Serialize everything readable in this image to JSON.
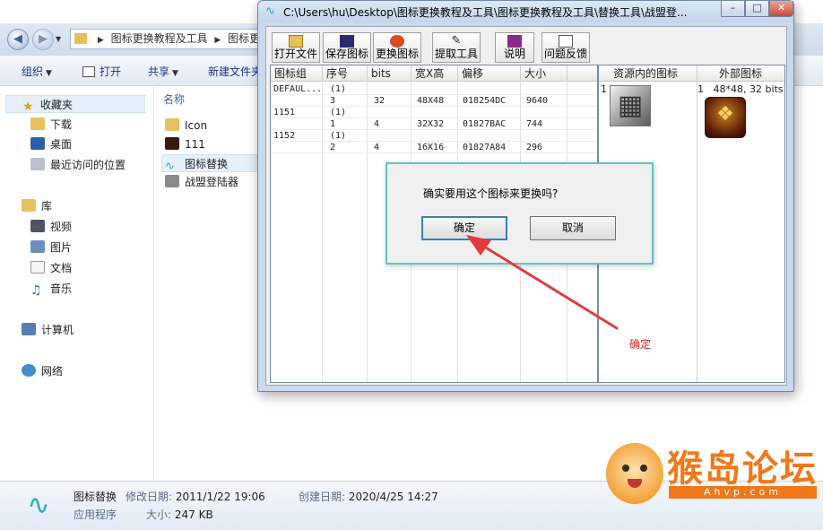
{
  "explorer": {
    "breadcrumb": [
      "图标更换教程及工具",
      "图标更"
    ],
    "toolbar": {
      "organize": "组织",
      "open": "打开",
      "share": "共享",
      "new_folder": "新建文件夹"
    },
    "nav": {
      "favorites": "收藏夹",
      "downloads": "下载",
      "desktop": "桌面",
      "recent": "最近访问的位置",
      "libraries": "库",
      "videos": "视频",
      "pictures": "图片",
      "documents": "文档",
      "music": "音乐",
      "computer": "计算机",
      "network": "网络"
    },
    "files": {
      "column_name": "名称",
      "items": [
        "Icon",
        "111",
        "图标替换",
        "战盟登陆器"
      ]
    },
    "status": {
      "name": "图标替换",
      "modified_label": "修改日期:",
      "modified": "2011/1/22 19:06",
      "created_label": "创建日期:",
      "created": "2020/4/25 14:27",
      "type": "应用程序",
      "size_label": "大小:",
      "size": "247 KB"
    }
  },
  "tool": {
    "title": "C:\\Users\\hu\\Desktop\\图标更换教程及工具\\图标更换教程及工具\\替换工具\\战盟登...",
    "buttons": [
      "打开文件",
      "保存图标",
      "更换图标",
      "提取工具",
      "说明",
      "问题反馈"
    ],
    "left_columns": [
      "图标组",
      "序号",
      "bits",
      "宽X高",
      "偏移",
      "大小"
    ],
    "rows": [
      [
        "DEFAUL...",
        "(1)",
        "",
        "",
        "",
        ""
      ],
      [
        "",
        "3",
        "32",
        "48X48",
        "018254DC",
        "9640"
      ],
      [
        "1151",
        "(1)",
        "",
        "",
        "",
        ""
      ],
      [
        "",
        "1",
        "4",
        "32X32",
        "01827BAC",
        "744"
      ],
      [
        "1152",
        "(1)",
        "",
        "",
        "",
        ""
      ],
      [
        "",
        "2",
        "4",
        "16X16",
        "01827A84",
        "296"
      ]
    ],
    "right_columns": [
      "资源内的图标",
      "外部图标"
    ],
    "resource_index": "1",
    "external_index": "1",
    "external_info": "48*48, 32 bits"
  },
  "dialog": {
    "message": "确实要用这个图标来更换吗?",
    "ok": "确定",
    "cancel": "取消"
  },
  "annotation": "确定",
  "watermark": {
    "text": "猴岛论坛",
    "sub": "Ahvp.com"
  },
  "colors": {
    "accent": "#3c7fb1",
    "annotation": "#e02020",
    "dialog_border": "#5fc3c8",
    "watermark": "#f07818"
  }
}
